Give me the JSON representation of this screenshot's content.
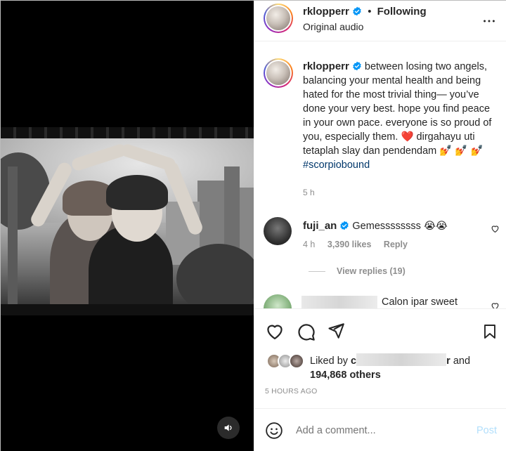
{
  "header": {
    "username": "rklopperr",
    "separator": "•",
    "follow_state": "Following",
    "audio": "Original audio",
    "more_icon": "more-horizontal-icon"
  },
  "caption": {
    "username": "rklopperr",
    "text_main": " between losing two angels, balancing your mental health and being hated for the most trivial thing— you’ve done your very best. hope you find peace in your own pace. everyone is so proud of you, especially them. ",
    "heart_emoji": "❤️",
    "text_tail": " dirgahayu uti tetaplah slay dan pendendam",
    "party_emoji": "💅 💅",
    "party_emoji_2": "💅",
    "hashtag": "#scorpiobound",
    "time": "5 h"
  },
  "comments": [
    {
      "username": "fuji_an",
      "text": "Gemessssssss",
      "emoji": "😭😭",
      "time": "4 h",
      "likes": "3,390 likes",
      "reply": "Reply",
      "view_replies": "View replies (19)"
    },
    {
      "text": "Calon ipar sweet"
    }
  ],
  "likes": {
    "prefix": "Liked by",
    "name_start": "c",
    "name_end": "r",
    "and": "and",
    "others": "194,868 others"
  },
  "post_time": "5 HOURS AGO",
  "comment_input": {
    "placeholder": "Add a comment...",
    "post_label": "Post"
  },
  "colors": {
    "link": "#00376b",
    "verified": "#0095f6",
    "muted": "#8e8e8e",
    "post_disabled": "#b2dffc",
    "heart": "#ed4956"
  }
}
